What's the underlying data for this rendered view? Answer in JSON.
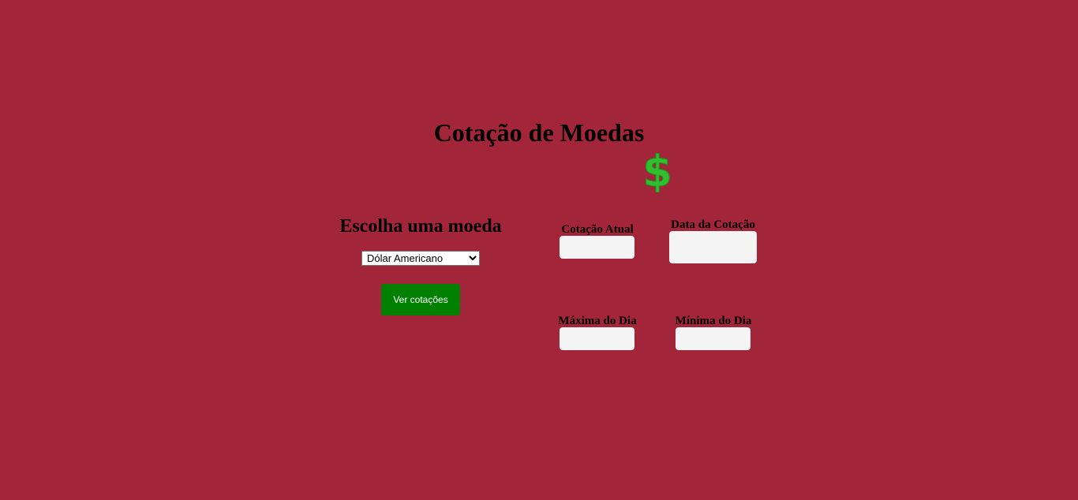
{
  "header": {
    "title": "Cotação de Moedas",
    "icon": "dollar-icon",
    "icon_color": "#2fbf2f"
  },
  "selector": {
    "heading": "Escolha uma moeda",
    "selected": "Dólar Americano",
    "options": [
      "Dólar Americano"
    ],
    "button_label": "Ver cotações",
    "button_color": "#008000"
  },
  "results": {
    "current_label": "Cotação Atual",
    "current_value": "",
    "date_label": "Data da Cotação",
    "date_value": "",
    "max_label": "Máxima do Dia",
    "max_value": "",
    "min_label": "Mínima do Dia",
    "min_value": ""
  },
  "colors": {
    "background": "#a3253a",
    "field_background": "#f4f4f4"
  }
}
